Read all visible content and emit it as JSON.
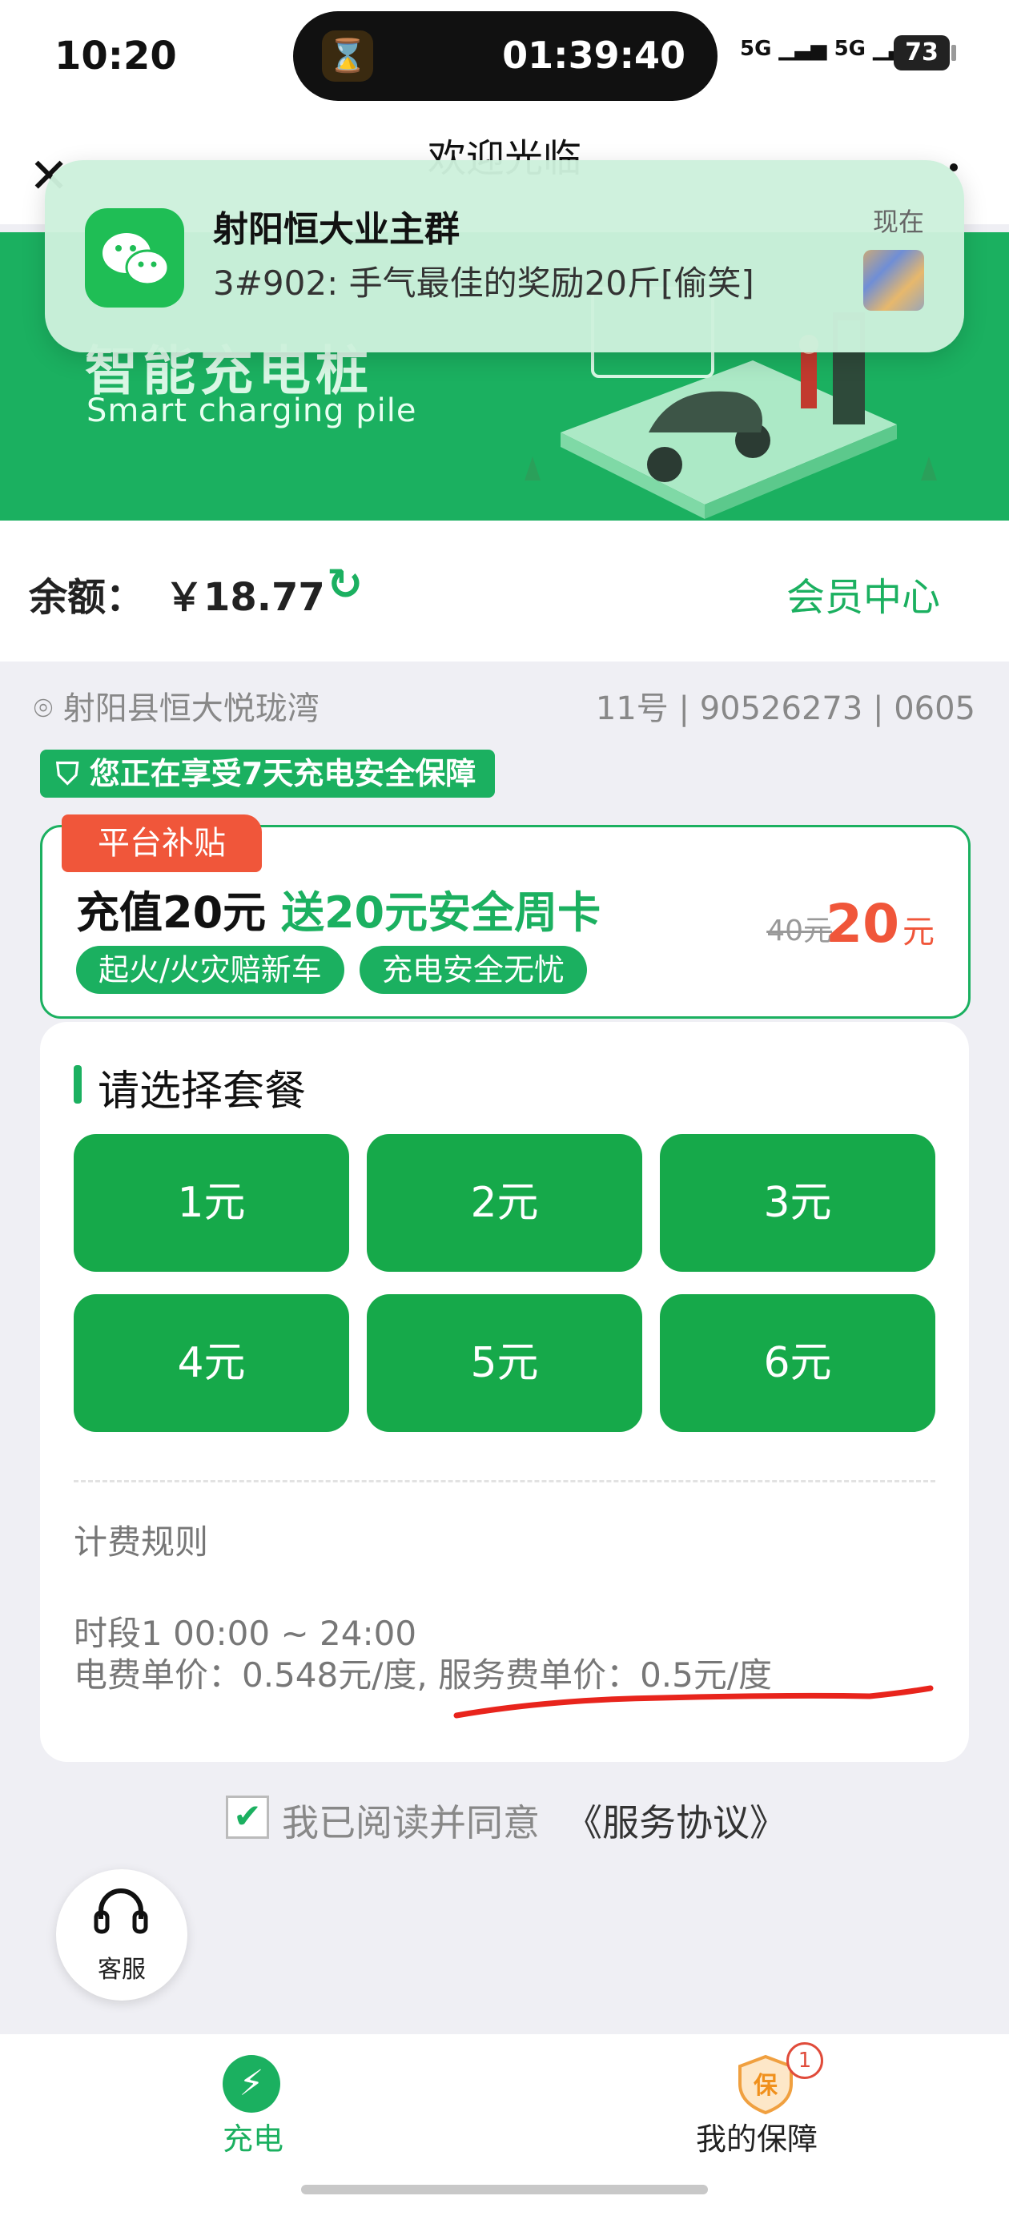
{
  "status_bar": {
    "time": "10:20",
    "timer": "01:39:40",
    "signal1": "5G",
    "signal2": "5G",
    "battery": "73"
  },
  "header": {
    "title": "欢迎光临"
  },
  "banner": {
    "title_cn": "智能充电桩",
    "title_en": "Smart charging pile"
  },
  "notification": {
    "title": "射阳恒大业主群",
    "body": "3#902: 手气最佳的奖励20斤[偷笑]",
    "time": "现在"
  },
  "balance": {
    "label": "余额：",
    "value": "￥18.77",
    "member_center": "会员中心"
  },
  "station": {
    "location": "射阳县恒大悦珑湾",
    "ids": "11号 | 90526273 | 0605"
  },
  "guarantee_badge": "您正在享受7天充电安全保障",
  "promo": {
    "tag": "平台补贴",
    "title_black": "充值20元",
    "title_green": " 送20元安全周卡",
    "chips": [
      "起火/火灾赔新车",
      "充电安全无忧"
    ],
    "old_price": "40元",
    "new_price": "20",
    "unit": "元"
  },
  "packages": {
    "title": "请选择套餐",
    "options": [
      "1元",
      "2元",
      "3元",
      "4元",
      "5元",
      "6元"
    ]
  },
  "billing": {
    "title": "计费规则",
    "period": "时段1 00:00 ~ 24:00",
    "price": "电费单价：0.548元/度, 服务费单价：0.5元/度"
  },
  "agreement": {
    "text": "我已阅读并同意",
    "link": "《服务协议》"
  },
  "customer_service": {
    "label": "客服"
  },
  "tabbar": {
    "charge": "充电",
    "guarantee": "我的保障",
    "guarantee_icon_text": "保",
    "badge": "1"
  },
  "colors": {
    "brand_green": "#1bb060",
    "accent_red": "#f0563a"
  }
}
